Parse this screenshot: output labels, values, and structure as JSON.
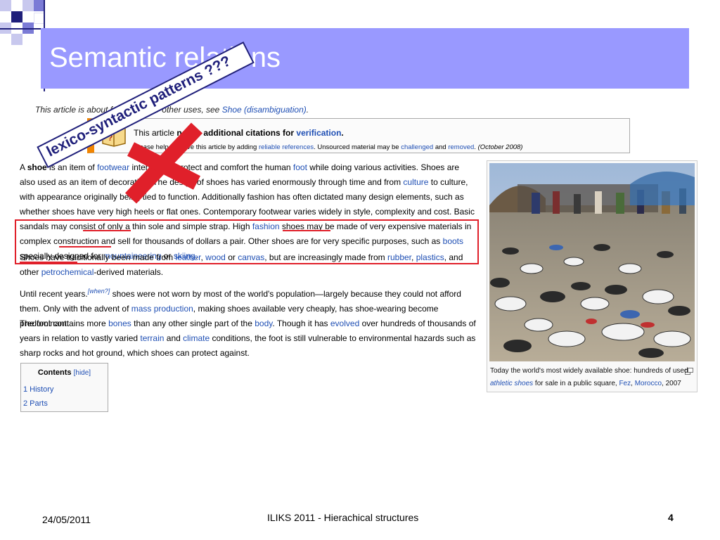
{
  "slide": {
    "title": "Semantic relations",
    "footer_date": "24/05/2011",
    "footer_center": "ILIKS 2011 - Hierachical structures",
    "page_number": "4"
  },
  "colors": {
    "title_band": "#9999ff",
    "accent_dark": "#1f1f7a",
    "accent_mid": "#7b7bd6",
    "accent_light": "#c8c8ee",
    "red": "#e0202a",
    "link": "#1f4fb4"
  },
  "annotation": {
    "text": "lexico-syntactic patterns ???",
    "cross_color": "#e0202a"
  },
  "article": {
    "hatnote": {
      "prefix": "This article is about footwear. For other uses, see ",
      "link": "Shoe (disambiguation)",
      "suffix": "."
    },
    "ambox": {
      "line1_a": "This article ",
      "line1_b": "needs additional citations",
      "line1_c": " for ",
      "line1_link": "verification",
      "line1_end": ".",
      "line2_a": "Please help improve this article by adding ",
      "line2_link1": "reliable references",
      "line2_b": ". Unsourced material may be ",
      "line2_link2": "challenged",
      "line2_c": " and ",
      "line2_link3": "removed",
      "line2_d": ". ",
      "line2_date": "(October 2008)"
    },
    "p1": [
      {
        "t": "A "
      },
      {
        "t": "shoe",
        "b": true
      },
      {
        "t": " is an item of "
      },
      {
        "t": "footwear",
        "l": true
      },
      {
        "t": " intended to protect and comfort the human "
      },
      {
        "t": "foot",
        "l": true
      },
      {
        "t": " while doing various activities. Shoes are also used as an item of decoration. The design of shoes has varied enormously through time and from "
      },
      {
        "t": "culture",
        "l": true
      },
      {
        "t": " to culture, with appearance originally being tied to function. Additionally fashion has often dictated many design elements, such as whether shoes have very high heels or flat ones. Contemporary footwear varies widely in style, complexity and cost. Basic sandals may consist of only a thin sole and simple strap. High "
      },
      {
        "t": "fashion",
        "l": true
      },
      {
        "t": " shoes may be made of very expensive materials in complex construction and sell for thousands of dollars a pair. Other shoes are for very specific purposes, such as "
      },
      {
        "t": "boots",
        "l": true
      },
      {
        "t": " specially designed for "
      },
      {
        "t": "mountaineering",
        "l": true
      },
      {
        "t": " or "
      },
      {
        "t": "skiing",
        "l": true
      },
      {
        "t": "."
      }
    ],
    "p2": [
      {
        "t": "Shoes have traditionally been made from "
      },
      {
        "t": "leather",
        "l": true
      },
      {
        "t": ", "
      },
      {
        "t": "wood",
        "l": true
      },
      {
        "t": " or "
      },
      {
        "t": "canvas",
        "l": true
      },
      {
        "t": ", but are increasingly made from "
      },
      {
        "t": "rubber",
        "l": true
      },
      {
        "t": ", "
      },
      {
        "t": "plastics",
        "l": true
      },
      {
        "t": ", and other "
      },
      {
        "t": "petrochemical",
        "l": true
      },
      {
        "t": "-derived materials."
      }
    ],
    "p3": [
      {
        "t": "Until recent years."
      },
      {
        "t": "[when?]",
        "l": true,
        "sup": true
      },
      {
        "t": " shoes were not worn by most of the world's population—largely because they could not afford them. Only with the advent of "
      },
      {
        "t": "mass production",
        "l": true
      },
      {
        "t": ", making shoes available very cheaply, has shoe-wearing become predominant."
      }
    ],
    "p4": [
      {
        "t": "The foot contains more "
      },
      {
        "t": "bones",
        "l": true
      },
      {
        "t": " than any other single part of the "
      },
      {
        "t": "body",
        "l": true
      },
      {
        "t": ". Though it has "
      },
      {
        "t": "evolved",
        "l": true
      },
      {
        "t": " over hundreds of thousands of years in relation to vastly varied "
      },
      {
        "t": "terrain",
        "l": true
      },
      {
        "t": " and "
      },
      {
        "t": "climate",
        "l": true
      },
      {
        "t": " conditions, the foot is still vulnerable to environmental hazards such as sharp rocks and hot ground, which shoes can protect against."
      }
    ],
    "toc": {
      "title": "Contents",
      "hide": "[hide]",
      "items": [
        "1 History",
        "2 Parts"
      ]
    },
    "image_caption": {
      "a": "Today the world's most widely available shoe: hundreds of used ",
      "link1": "athletic shoes",
      "b": " for sale in a public square, ",
      "link2": "Fez",
      "c": ", ",
      "link3": "Morocco",
      "d": ", 2007"
    }
  }
}
